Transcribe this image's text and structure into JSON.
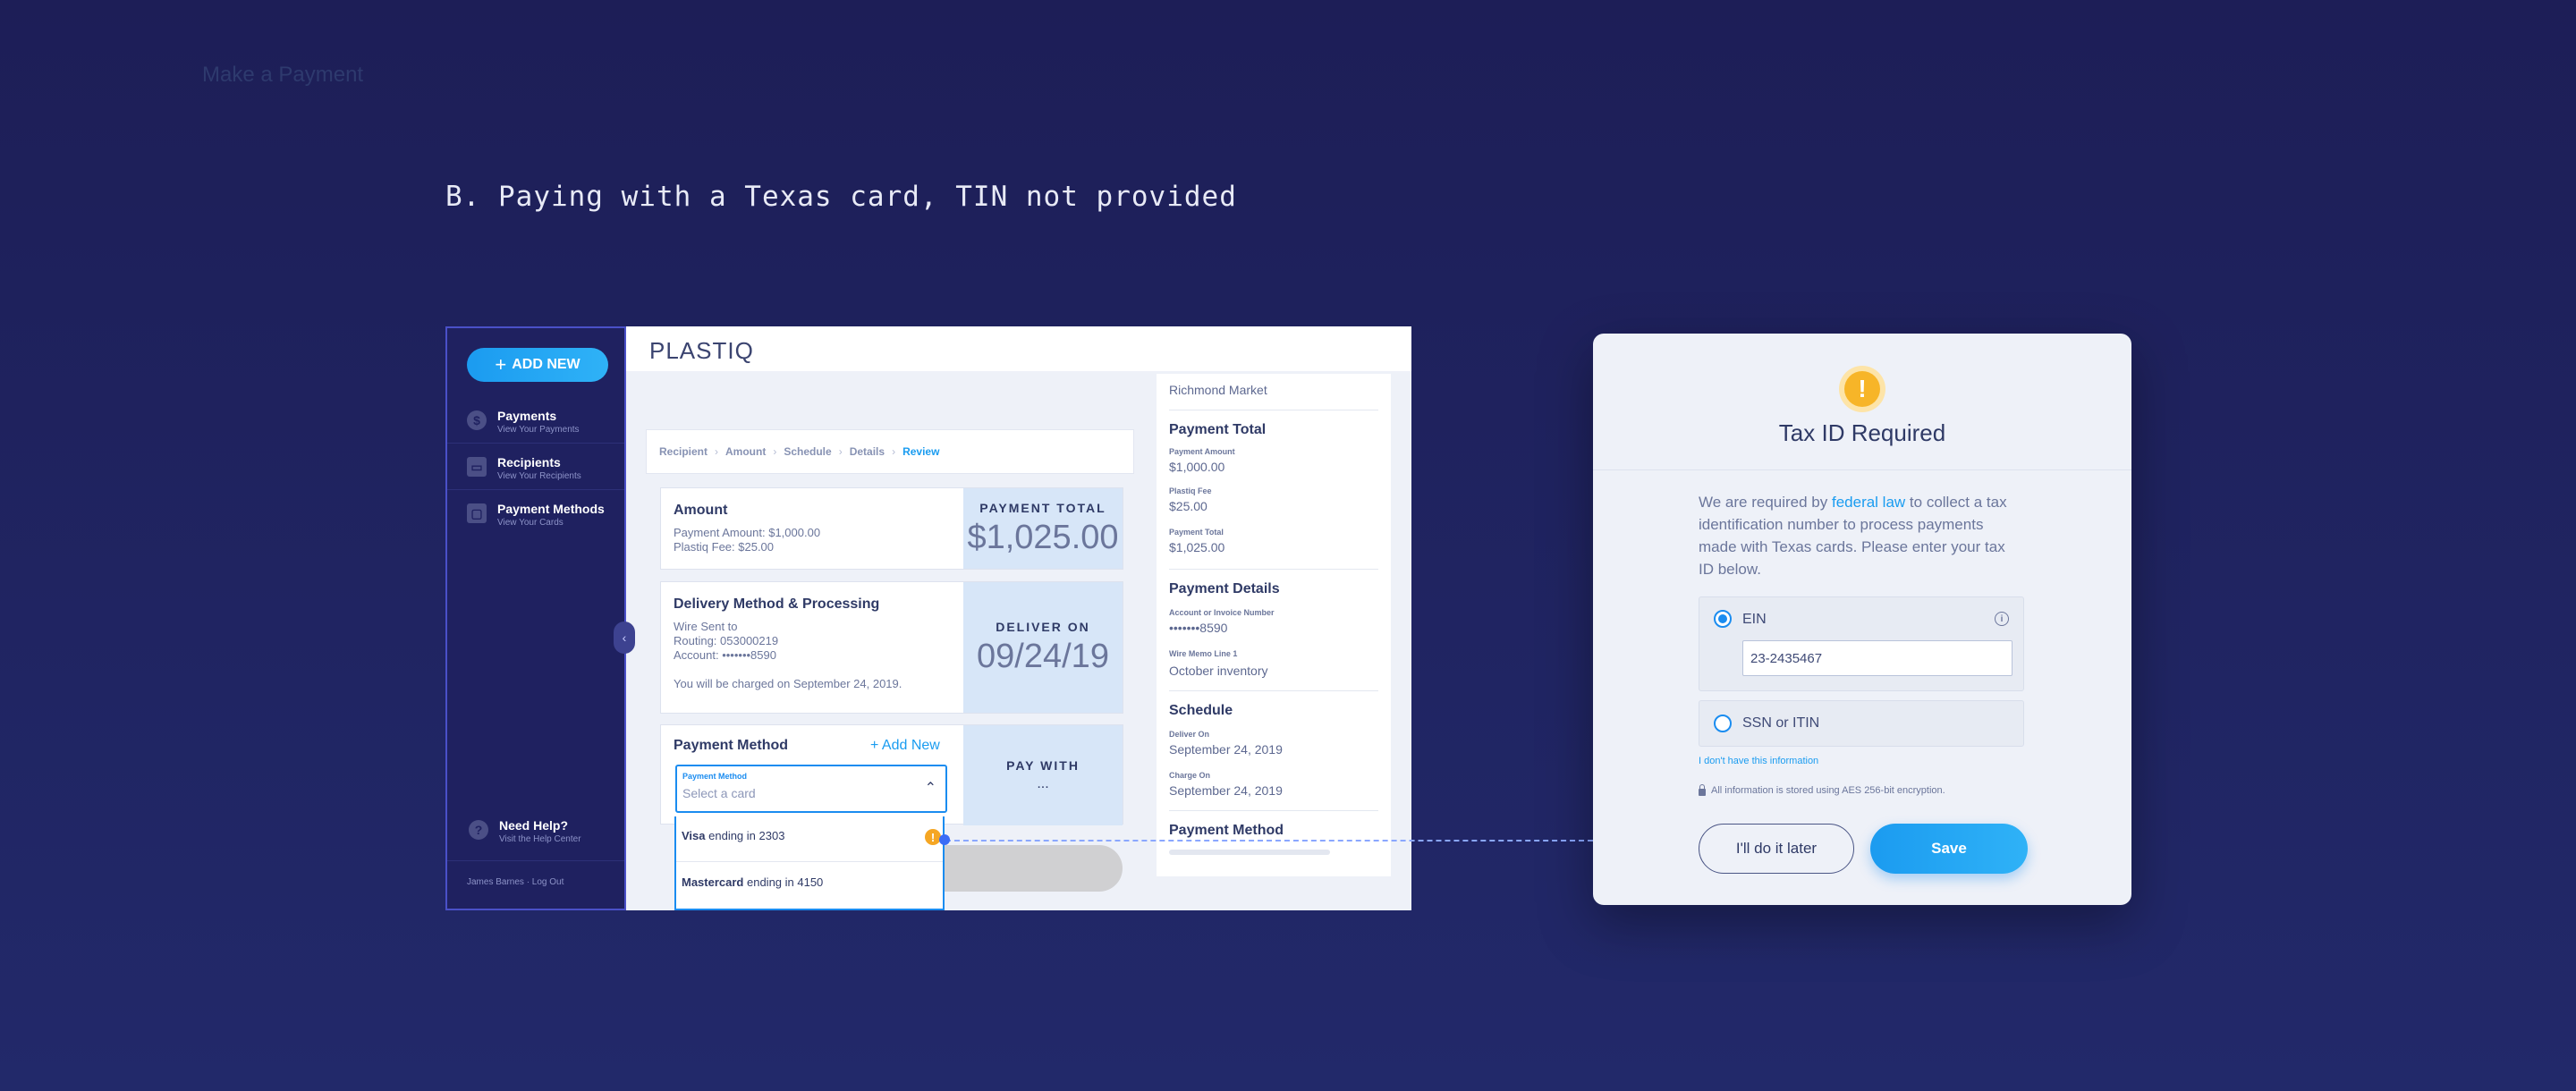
{
  "caption": "B. Paying with a Texas card, TIN not provided",
  "sidebar": {
    "add_new": "ADD NEW",
    "items": [
      {
        "icon": "$",
        "title": "Payments",
        "sub": "View Your Payments"
      },
      {
        "icon": "▭",
        "title": "Recipients",
        "sub": "View Your Recipients"
      },
      {
        "icon": "▢",
        "title": "Payment Methods",
        "sub": "View Your Cards"
      }
    ],
    "help_title": "Need Help?",
    "help_sub": "Visit the Help Center",
    "user_line": "James Barnes · Log Out"
  },
  "topbar": {
    "logo": "PLASTIQ"
  },
  "page_title": "Make a Payment",
  "breadcrumb": [
    "Recipient",
    "Amount",
    "Schedule",
    "Details",
    "Review"
  ],
  "amount_card": {
    "title": "Amount",
    "line1": "Payment Amount: $1,000.00",
    "line2": "Plastiq Fee: $25.00",
    "total_label": "PAYMENT TOTAL",
    "total_value": "$1,025.00"
  },
  "delivery_card": {
    "title": "Delivery Method & Processing",
    "line1": "Wire Sent to",
    "line2": "Routing: 053000219",
    "line3": "Account: •••••••8590",
    "note": "You will be charged on September 24, 2019.",
    "deliver_label": "DELIVER ON",
    "deliver_value": "09/24/19"
  },
  "payment_method_card": {
    "title": "Payment Method",
    "add_new": "+ Add New",
    "field_label": "Payment Method",
    "placeholder": "Select a card",
    "pay_with_label": "PAY WITH",
    "pay_with_value": "..."
  },
  "dropdown": [
    {
      "brand": "Visa",
      "rest": " ending in 2303"
    },
    {
      "brand": "Mastercard",
      "rest": " ending in 4150"
    }
  ],
  "receipt": {
    "top_value": "Richmond Market",
    "payment_total_h": "Payment Total",
    "payment_amount_l": "Payment Amount",
    "payment_amount_v": "$1,000.00",
    "fee_l": "Plastiq Fee",
    "fee_v": "$25.00",
    "total_l": "Payment Total",
    "total_v": "$1,025.00",
    "details_h": "Payment Details",
    "acct_l": "Account or Invoice Number",
    "acct_v": "•••••••8590",
    "memo_l": "Wire Memo Line 1",
    "memo_v": "October inventory",
    "schedule_h": "Schedule",
    "deliver_l": "Deliver On",
    "deliver_v": "September 24, 2019",
    "charge_l": "Charge On",
    "charge_v": "September 24, 2019",
    "method_h": "Payment Method"
  },
  "modal": {
    "title": "Tax ID Required",
    "body_pre": "We are required by ",
    "body_link": "federal law",
    "body_post": " to collect a tax identification number to process payments made with Texas cards. Please enter your tax ID below.",
    "ein_label": "EIN",
    "ein_value": "23-2435467",
    "ssn_label": "SSN or ITIN",
    "no_info": "I don't have this information",
    "secure": "All information is stored using AES 256-bit encryption.",
    "later_button": "I'll do it later",
    "save_button": "Save"
  },
  "colors": {
    "accent": "#1a9cf0",
    "warning": "#f5a623",
    "background": "#1d1e57"
  }
}
